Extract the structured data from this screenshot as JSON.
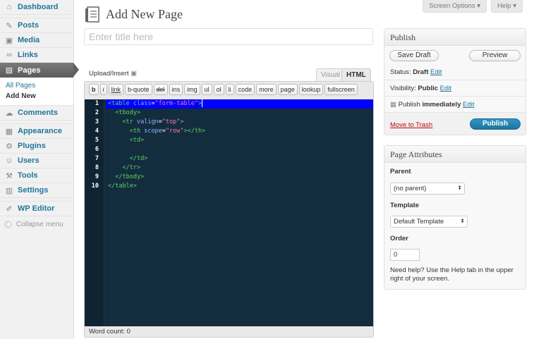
{
  "sidebar": {
    "items": [
      {
        "label": "Dashboard",
        "icon": "⌂"
      },
      {
        "label": "Posts",
        "icon": "✎"
      },
      {
        "label": "Media",
        "icon": "▣"
      },
      {
        "label": "Links",
        "icon": "∞"
      },
      {
        "label": "Pages",
        "icon": "▤"
      },
      {
        "label": "Comments",
        "icon": "☁"
      },
      {
        "label": "Appearance",
        "icon": "▦"
      },
      {
        "label": "Plugins",
        "icon": "⚙"
      },
      {
        "label": "Users",
        "icon": "☺"
      },
      {
        "label": "Tools",
        "icon": "⚒"
      },
      {
        "label": "Settings",
        "icon": "▥"
      },
      {
        "label": "WP Editor",
        "icon": "✐"
      }
    ],
    "pages_submenu": [
      "All Pages",
      "Add New"
    ],
    "collapse_label": "Collapse menu"
  },
  "screen_meta": {
    "screen_options": "Screen Options ▾",
    "help": "Help ▾"
  },
  "page_title": "Add New Page",
  "title_placeholder": "Enter title here",
  "editor": {
    "upload_insert": "Upload/Insert",
    "tab_visual": "Visual",
    "tab_html": "HTML",
    "toolbar": [
      "b",
      "i",
      "link",
      "b-quote",
      "del",
      "ins",
      "img",
      "ul",
      "ol",
      "li",
      "code",
      "more",
      "page",
      "lookup",
      "fullscreen"
    ],
    "line_numbers": [
      "1",
      "2",
      "3",
      "4",
      "5",
      "6",
      "7",
      "8",
      "9",
      "10"
    ],
    "word_count": "Word count: 0"
  },
  "publish": {
    "title": "Publish",
    "save_draft": "Save Draft",
    "preview": "Preview",
    "status_label": "Status:",
    "status_value": "Draft",
    "visibility_label": "Visibility:",
    "visibility_value": "Public",
    "publish_label": "Publish",
    "publish_value": "immediately",
    "edit": "Edit",
    "move_to_trash": "Move to Trash",
    "publish_button": "Publish"
  },
  "page_attributes": {
    "title": "Page Attributes",
    "parent_label": "Parent",
    "parent_value": "(no parent)",
    "template_label": "Template",
    "template_value": "Default Template",
    "order_label": "Order",
    "order_value": "0",
    "help_text": "Need help? Use the Help tab in the upper right of your screen."
  }
}
